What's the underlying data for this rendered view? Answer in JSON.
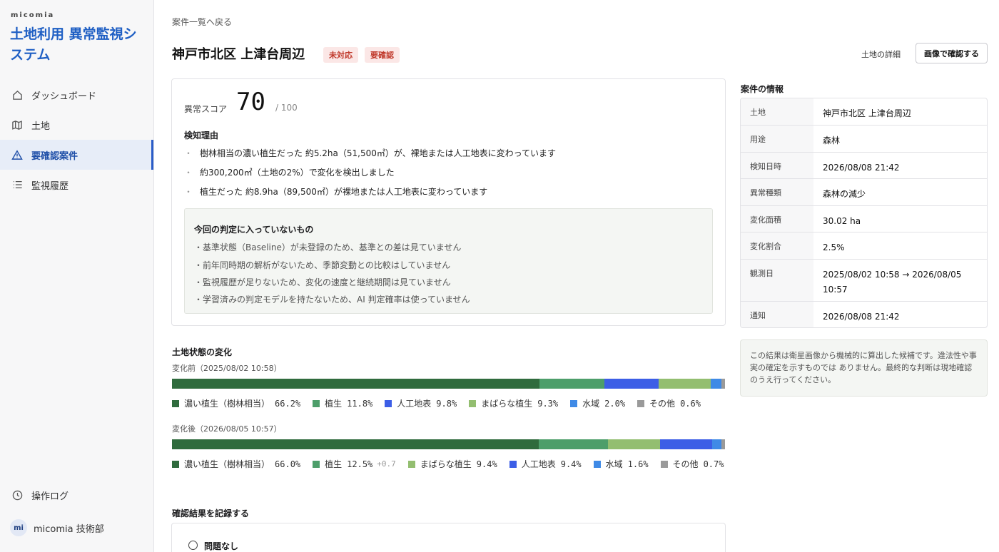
{
  "sidebar": {
    "brand_small": "micomia",
    "brand_title": "土地利用 異常監視システム",
    "items": [
      {
        "label": "ダッシュボード",
        "icon": "home-icon"
      },
      {
        "label": "土地",
        "icon": "map-icon"
      },
      {
        "label": "要確認案件",
        "icon": "warning-icon"
      },
      {
        "label": "監視履歴",
        "icon": "list-icon"
      }
    ],
    "bottom_item": {
      "label": "操作ログ",
      "icon": "clock-icon"
    },
    "user": {
      "initials": "mi",
      "name": "micomia 技術部"
    }
  },
  "header": {
    "back_link": "案件一覧へ戻る",
    "title": "神戸市北区 上津台周辺",
    "badges": [
      "未対応",
      "要確認"
    ],
    "detail_link": "土地の詳細",
    "image_button": "画像で確認する"
  },
  "score": {
    "label": "異常スコア",
    "value": "70",
    "max": "/ 100"
  },
  "reasons": {
    "heading": "検知理由",
    "bullet": "・",
    "items": [
      "樹林相当の濃い植生だった 約5.2ha（51,500㎡）が、裸地または人工地表に変わっています",
      "約300,200㎡（土地の2%）で変化を検出しました",
      "植生だった 約8.9ha（89,500㎡）が裸地または人工地表に変わっています"
    ]
  },
  "excluded": {
    "heading": "今回の判定に入っていないもの",
    "items": [
      "・基準状態（Baseline）が未登録のため、基準との差は見ていません",
      "・前年同時期の解析がないため、季節変動との比較はしていません",
      "・監視履歴が足りないため、変化の速度と継続期間は見ていません",
      "・学習済みの判定モデルを持たないため、AI 判定確率は使っていません"
    ]
  },
  "land_change": {
    "heading": "土地状態の変化",
    "before_label": "変化前（2025/08/02 10:58）",
    "after_label": "変化後（2026/08/05 10:57）",
    "colors": {
      "dense": "#2f6b3d",
      "veg": "#4d9e6a",
      "artificial": "#3c5ee6",
      "sparse": "#93be70",
      "water": "#3f8ae6",
      "other": "#9a9a9a"
    }
  },
  "chart_data": {
    "type": "bar",
    "stacked": true,
    "orientation": "horizontal",
    "series": [
      {
        "name": "変化前（2025/08/02 10:58）",
        "segments": [
          {
            "label": "濃い植生（樹林相当）",
            "value": 66.2,
            "text": "66.2%",
            "key": "dense"
          },
          {
            "label": "植生",
            "value": 11.8,
            "text": "11.8%",
            "key": "veg"
          },
          {
            "label": "人工地表",
            "value": 9.8,
            "text": "9.8%",
            "key": "artificial"
          },
          {
            "label": "まばらな植生",
            "value": 9.3,
            "text": "9.3%",
            "key": "sparse"
          },
          {
            "label": "水域",
            "value": 2.0,
            "text": "2.0%",
            "key": "water"
          },
          {
            "label": "その他",
            "value": 0.6,
            "text": "0.6%",
            "key": "other"
          }
        ],
        "bar_order": [
          "dense",
          "veg",
          "artificial",
          "sparse",
          "water",
          "other"
        ]
      },
      {
        "name": "変化後（2026/08/05 10:57）",
        "segments": [
          {
            "label": "濃い植生（樹林相当）",
            "value": 66.0,
            "text": "66.0%",
            "key": "dense"
          },
          {
            "label": "植生",
            "value": 12.5,
            "text": "12.5%",
            "delta": "+0.7",
            "key": "veg"
          },
          {
            "label": "まばらな植生",
            "value": 9.4,
            "text": "9.4%",
            "key": "sparse"
          },
          {
            "label": "人工地表",
            "value": 9.4,
            "text": "9.4%",
            "key": "artificial"
          },
          {
            "label": "水域",
            "value": 1.6,
            "text": "1.6%",
            "key": "water"
          },
          {
            "label": "その他",
            "value": 0.7,
            "text": "0.7%",
            "key": "other"
          }
        ],
        "bar_order": [
          "dense",
          "veg",
          "sparse",
          "artificial",
          "water",
          "other"
        ]
      }
    ]
  },
  "record": {
    "heading": "確認結果を記録する",
    "option_label": "問題なし"
  },
  "info": {
    "heading": "案件の情報",
    "rows": [
      {
        "key": "土地",
        "value": "神戸市北区 上津台周辺"
      },
      {
        "key": "用途",
        "value": "森林"
      },
      {
        "key": "検知日時",
        "value": "2026/08/08 21:42"
      },
      {
        "key": "異常種類",
        "value": "森林の減少"
      },
      {
        "key": "変化面積",
        "value": "30.02 ha"
      },
      {
        "key": "変化割合",
        "value": "2.5%"
      },
      {
        "key": "観測日",
        "value": "2025/08/02 10:58 → 2026/08/05 10:57"
      },
      {
        "key": "通知",
        "value": "2026/08/08 21:42"
      }
    ],
    "disclaimer": "この結果は衛星画像から機械的に算出した候補です。違法性や事実の確定を示すものでは ありません。最終的な判断は現地確認のうえ行ってください。"
  }
}
